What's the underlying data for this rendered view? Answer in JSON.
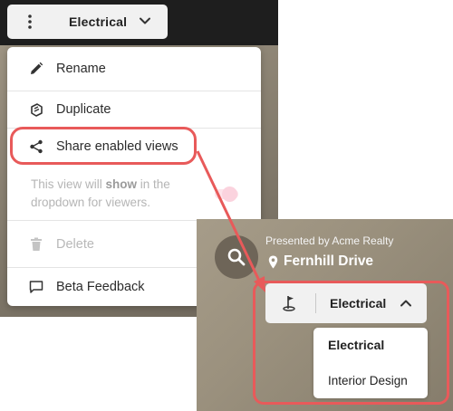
{
  "left": {
    "view_selector": {
      "label": "Electrical"
    },
    "menu": {
      "items": [
        {
          "label": "Rename",
          "icon": "pencil-icon"
        },
        {
          "label": "Duplicate",
          "icon": "duplicate-icon"
        },
        {
          "label": "Share enabled views",
          "icon": "share-icon"
        },
        {
          "label": "Delete",
          "icon": "trash-icon",
          "disabled": true
        },
        {
          "label": "Beta Feedback",
          "icon": "feedback-icon"
        }
      ],
      "hint_before": "This view will ",
      "hint_bold": "show",
      "hint_after": " in the dropdown for viewers."
    }
  },
  "right": {
    "presented_by": "Presented by Acme Realty",
    "address": "Fernhill Drive",
    "view_selector": {
      "label": "Electrical"
    },
    "dropdown": {
      "options": [
        "Electrical",
        "Interior Design"
      ],
      "selected": "Electrical"
    }
  },
  "colors": {
    "highlight": "#e85a5a",
    "topbar": "#1e1e1e"
  }
}
